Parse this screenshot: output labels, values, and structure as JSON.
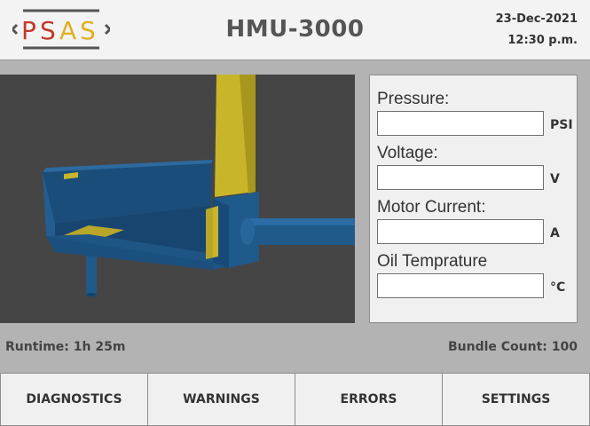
{
  "header": {
    "logo_text": "PSAS",
    "title": "HMU-3000",
    "date": "23-Dec-2021",
    "time": "12:30 p.m."
  },
  "readings": [
    {
      "label": "Pressure:",
      "value": "",
      "unit": "PSI"
    },
    {
      "label": "Voltage:",
      "value": "",
      "unit": "V"
    },
    {
      "label": "Motor Current:",
      "value": "",
      "unit": "A"
    },
    {
      "label": "Oil Temprature",
      "value": "",
      "unit": "°C"
    }
  ],
  "status": {
    "runtime": "Runtime: 1h 25m",
    "bundle_count": "Bundle Count: 100"
  },
  "nav": [
    {
      "label": "DIAGNOSTICS"
    },
    {
      "label": "WARNINGS"
    },
    {
      "label": "ERRORS"
    },
    {
      "label": "SETTINGS"
    }
  ],
  "colors": {
    "logo_red": "#c0392b",
    "logo_yellow": "#e0b020",
    "model_blue": "#1f4e79",
    "model_yellow": "#c9b52a"
  }
}
